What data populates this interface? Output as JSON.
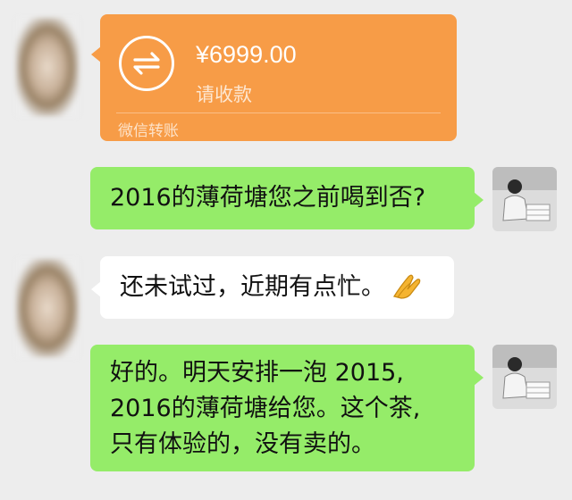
{
  "transfer": {
    "amount": "¥6999.00",
    "status": "请收款",
    "footer": "微信转账",
    "icon": "transfer-arrows-icon",
    "color": "#f79c47"
  },
  "messages": [
    {
      "sender": "self",
      "text": "2016的薄荷塘您之前喝到否?"
    },
    {
      "sender": "other",
      "text": "还未试过，近期有点忙。",
      "emoji": "folded-hands"
    },
    {
      "sender": "self",
      "lines": [
        "好的。明天安排一泡 2015,",
        "2016的薄荷塘给您。这个茶,",
        "只有体验的，没有卖的。"
      ]
    }
  ],
  "colors": {
    "background": "#ededed",
    "self_bubble": "#95ec69",
    "other_bubble": "#ffffff"
  }
}
